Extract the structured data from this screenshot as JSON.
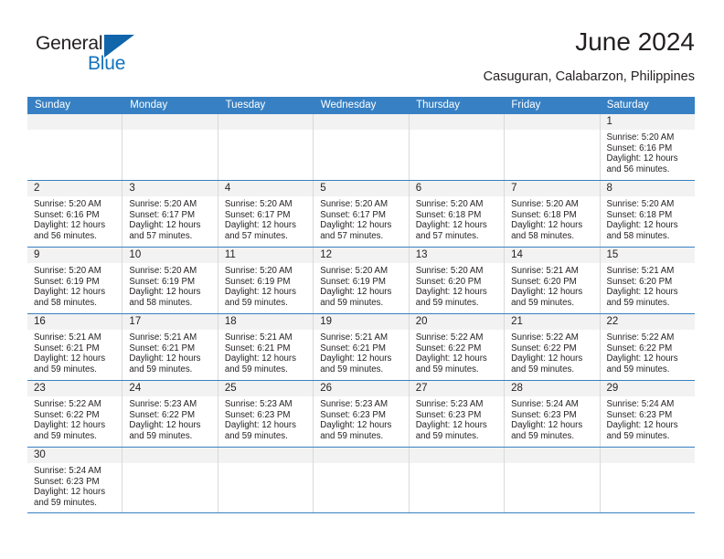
{
  "brand": {
    "name_top": "General",
    "name_bottom": "Blue",
    "accent_color": "#1165ab",
    "text_color": "#1473bd"
  },
  "header": {
    "title": "June 2024",
    "subtitle": "Casuguran, Calabarzon, Philippines"
  },
  "calendar": {
    "header_bg": "#3780c3",
    "weekdays": [
      "Sunday",
      "Monday",
      "Tuesday",
      "Wednesday",
      "Thursday",
      "Friday",
      "Saturday"
    ],
    "weeks": [
      [
        {
          "date": "",
          "lines": []
        },
        {
          "date": "",
          "lines": []
        },
        {
          "date": "",
          "lines": []
        },
        {
          "date": "",
          "lines": []
        },
        {
          "date": "",
          "lines": []
        },
        {
          "date": "",
          "lines": []
        },
        {
          "date": "1",
          "lines": [
            "Sunrise: 5:20 AM",
            "Sunset: 6:16 PM",
            "Daylight: 12 hours",
            "and 56 minutes."
          ]
        }
      ],
      [
        {
          "date": "2",
          "lines": [
            "Sunrise: 5:20 AM",
            "Sunset: 6:16 PM",
            "Daylight: 12 hours",
            "and 56 minutes."
          ]
        },
        {
          "date": "3",
          "lines": [
            "Sunrise: 5:20 AM",
            "Sunset: 6:17 PM",
            "Daylight: 12 hours",
            "and 57 minutes."
          ]
        },
        {
          "date": "4",
          "lines": [
            "Sunrise: 5:20 AM",
            "Sunset: 6:17 PM",
            "Daylight: 12 hours",
            "and 57 minutes."
          ]
        },
        {
          "date": "5",
          "lines": [
            "Sunrise: 5:20 AM",
            "Sunset: 6:17 PM",
            "Daylight: 12 hours",
            "and 57 minutes."
          ]
        },
        {
          "date": "6",
          "lines": [
            "Sunrise: 5:20 AM",
            "Sunset: 6:18 PM",
            "Daylight: 12 hours",
            "and 57 minutes."
          ]
        },
        {
          "date": "7",
          "lines": [
            "Sunrise: 5:20 AM",
            "Sunset: 6:18 PM",
            "Daylight: 12 hours",
            "and 58 minutes."
          ]
        },
        {
          "date": "8",
          "lines": [
            "Sunrise: 5:20 AM",
            "Sunset: 6:18 PM",
            "Daylight: 12 hours",
            "and 58 minutes."
          ]
        }
      ],
      [
        {
          "date": "9",
          "lines": [
            "Sunrise: 5:20 AM",
            "Sunset: 6:19 PM",
            "Daylight: 12 hours",
            "and 58 minutes."
          ]
        },
        {
          "date": "10",
          "lines": [
            "Sunrise: 5:20 AM",
            "Sunset: 6:19 PM",
            "Daylight: 12 hours",
            "and 58 minutes."
          ]
        },
        {
          "date": "11",
          "lines": [
            "Sunrise: 5:20 AM",
            "Sunset: 6:19 PM",
            "Daylight: 12 hours",
            "and 59 minutes."
          ]
        },
        {
          "date": "12",
          "lines": [
            "Sunrise: 5:20 AM",
            "Sunset: 6:19 PM",
            "Daylight: 12 hours",
            "and 59 minutes."
          ]
        },
        {
          "date": "13",
          "lines": [
            "Sunrise: 5:20 AM",
            "Sunset: 6:20 PM",
            "Daylight: 12 hours",
            "and 59 minutes."
          ]
        },
        {
          "date": "14",
          "lines": [
            "Sunrise: 5:21 AM",
            "Sunset: 6:20 PM",
            "Daylight: 12 hours",
            "and 59 minutes."
          ]
        },
        {
          "date": "15",
          "lines": [
            "Sunrise: 5:21 AM",
            "Sunset: 6:20 PM",
            "Daylight: 12 hours",
            "and 59 minutes."
          ]
        }
      ],
      [
        {
          "date": "16",
          "lines": [
            "Sunrise: 5:21 AM",
            "Sunset: 6:21 PM",
            "Daylight: 12 hours",
            "and 59 minutes."
          ]
        },
        {
          "date": "17",
          "lines": [
            "Sunrise: 5:21 AM",
            "Sunset: 6:21 PM",
            "Daylight: 12 hours",
            "and 59 minutes."
          ]
        },
        {
          "date": "18",
          "lines": [
            "Sunrise: 5:21 AM",
            "Sunset: 6:21 PM",
            "Daylight: 12 hours",
            "and 59 minutes."
          ]
        },
        {
          "date": "19",
          "lines": [
            "Sunrise: 5:21 AM",
            "Sunset: 6:21 PM",
            "Daylight: 12 hours",
            "and 59 minutes."
          ]
        },
        {
          "date": "20",
          "lines": [
            "Sunrise: 5:22 AM",
            "Sunset: 6:22 PM",
            "Daylight: 12 hours",
            "and 59 minutes."
          ]
        },
        {
          "date": "21",
          "lines": [
            "Sunrise: 5:22 AM",
            "Sunset: 6:22 PM",
            "Daylight: 12 hours",
            "and 59 minutes."
          ]
        },
        {
          "date": "22",
          "lines": [
            "Sunrise: 5:22 AM",
            "Sunset: 6:22 PM",
            "Daylight: 12 hours",
            "and 59 minutes."
          ]
        }
      ],
      [
        {
          "date": "23",
          "lines": [
            "Sunrise: 5:22 AM",
            "Sunset: 6:22 PM",
            "Daylight: 12 hours",
            "and 59 minutes."
          ]
        },
        {
          "date": "24",
          "lines": [
            "Sunrise: 5:23 AM",
            "Sunset: 6:22 PM",
            "Daylight: 12 hours",
            "and 59 minutes."
          ]
        },
        {
          "date": "25",
          "lines": [
            "Sunrise: 5:23 AM",
            "Sunset: 6:23 PM",
            "Daylight: 12 hours",
            "and 59 minutes."
          ]
        },
        {
          "date": "26",
          "lines": [
            "Sunrise: 5:23 AM",
            "Sunset: 6:23 PM",
            "Daylight: 12 hours",
            "and 59 minutes."
          ]
        },
        {
          "date": "27",
          "lines": [
            "Sunrise: 5:23 AM",
            "Sunset: 6:23 PM",
            "Daylight: 12 hours",
            "and 59 minutes."
          ]
        },
        {
          "date": "28",
          "lines": [
            "Sunrise: 5:24 AM",
            "Sunset: 6:23 PM",
            "Daylight: 12 hours",
            "and 59 minutes."
          ]
        },
        {
          "date": "29",
          "lines": [
            "Sunrise: 5:24 AM",
            "Sunset: 6:23 PM",
            "Daylight: 12 hours",
            "and 59 minutes."
          ]
        }
      ],
      [
        {
          "date": "30",
          "lines": [
            "Sunrise: 5:24 AM",
            "Sunset: 6:23 PM",
            "Daylight: 12 hours",
            "and 59 minutes."
          ]
        },
        {
          "date": "",
          "lines": []
        },
        {
          "date": "",
          "lines": []
        },
        {
          "date": "",
          "lines": []
        },
        {
          "date": "",
          "lines": []
        },
        {
          "date": "",
          "lines": []
        },
        {
          "date": "",
          "lines": []
        }
      ]
    ]
  }
}
